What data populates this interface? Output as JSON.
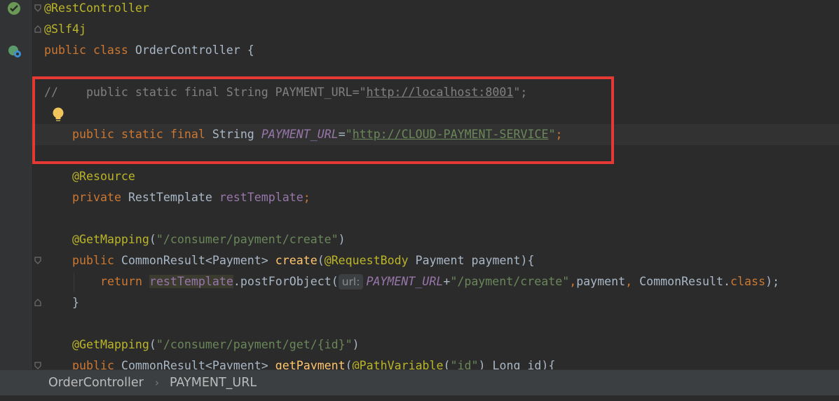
{
  "code": {
    "l1_annotation": "@RestController",
    "l2_annotation": "@Slf4j",
    "l3_public": "public",
    "l3_class": "class",
    "l3_name": "OrderController {",
    "l5_comment_prefix": "//    public static final String PAYMENT_URL=\"",
    "l5_url": "http://localhost:8001",
    "l5_comment_suffix": "\";",
    "l7_public": "public",
    "l7_static": "static",
    "l7_final": "final",
    "l7_type": "String",
    "l7_field": "PAYMENT_URL",
    "l7_eq": "=",
    "l7_quote_open": "\"",
    "l7_url": "http://CLOUD-PAYMENT-SERVICE",
    "l7_quote_close": "\"",
    "l7_semi": ";",
    "l9_annotation": "@Resource",
    "l10_private": "private",
    "l10_type": "RestTemplate",
    "l10_field": "restTemplate",
    "l10_semi": ";",
    "l12_annotation": "@GetMapping",
    "l12_open": "(",
    "l12_path": "\"/consumer/payment/create\"",
    "l12_close": ")",
    "l13_public": "public",
    "l13_type": "CommonResult<Payment>",
    "l13_method": "create",
    "l13_open": "(",
    "l13_param_ann": "@RequestBody",
    "l13_params": "Payment payment){",
    "l14_return": "return",
    "l14_ref": "restTemplate",
    "l14_call": ".postForObject(",
    "l14_hint": "url:",
    "l14_field": "PAYMENT_URL",
    "l14_plus": "+",
    "l14_path": "\"/payment/create\"",
    "l14_comma1": ",",
    "l14_payment": "payment",
    "l14_comma2": ",",
    "l14_result": "CommonResult.",
    "l14_class": "class",
    "l14_end": ");",
    "l15_brace": "}",
    "l17_annotation": "@GetMapping",
    "l17_open": "(",
    "l17_path": "\"/consumer/payment/get/{id}\"",
    "l17_close": ")",
    "l18_public": "public",
    "l18_type": "CommonResult<Payment>",
    "l18_method": "getPayment",
    "l18_open": "(",
    "l18_param_ann": "@PathVariable",
    "l18_arg_open": "(",
    "l18_arg": "\"id\"",
    "l18_rest": ") Long id){"
  },
  "breadcrumb": {
    "item1": "OrderController",
    "separator": "›",
    "item2": "PAYMENT_URL"
  },
  "colors": {
    "keyword": "#cc7832",
    "annotation": "#bbb529",
    "string": "#6a8759",
    "field": "#9876aa",
    "method": "#ffc66d",
    "comment": "#808080",
    "highlight_box": "#e53935"
  },
  "icons": [
    "spring-bean-icon",
    "run-class-icon",
    "intention-bulb-icon",
    "fold-icon"
  ]
}
